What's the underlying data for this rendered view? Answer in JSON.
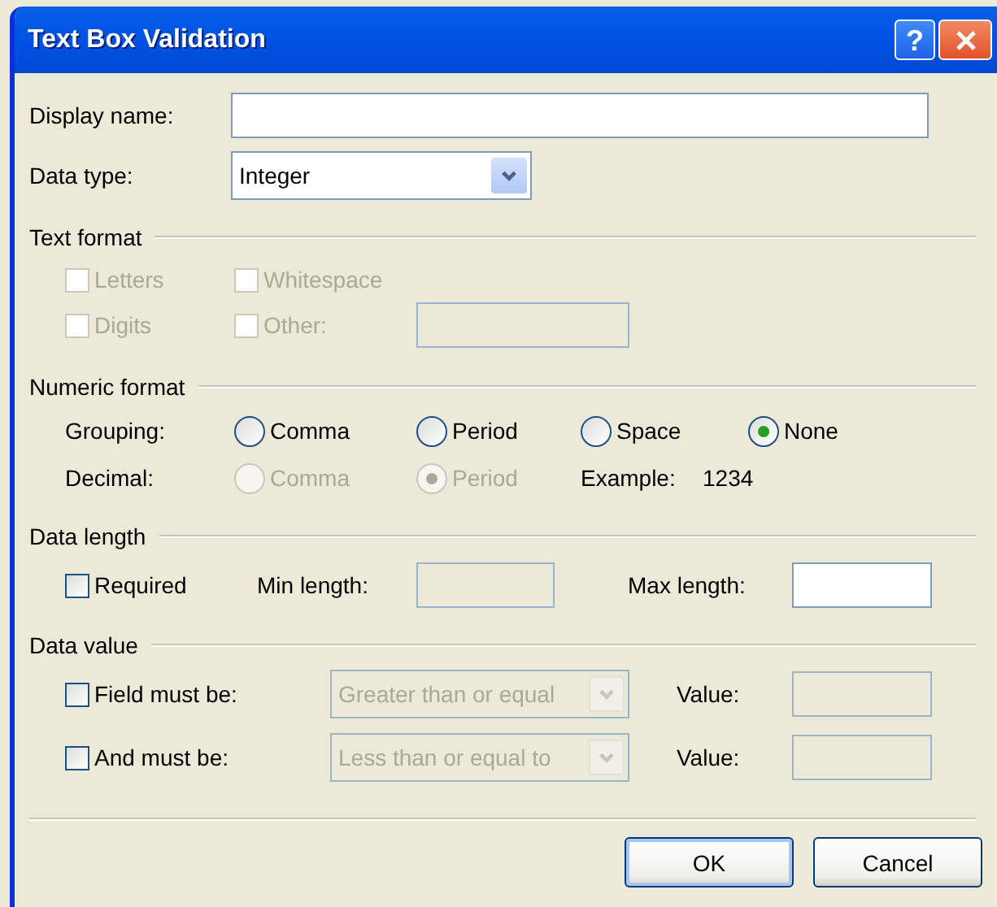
{
  "window": {
    "title": "Text Box Validation",
    "help_label": "?"
  },
  "display_name": {
    "label": "Display name:",
    "disabled": false
  },
  "data_type": {
    "label": "Data type:",
    "value": "Integer",
    "disabled": false
  },
  "text_format": {
    "title": "Text format",
    "options": [
      {
        "label": "Letters",
        "checked": false,
        "disabled": true
      },
      {
        "label": "Whitespace",
        "checked": false,
        "disabled": true
      },
      {
        "label": "Digits",
        "checked": false,
        "disabled": true
      },
      {
        "label": "Other:",
        "checked": false,
        "disabled": true
      }
    ],
    "other_field": {
      "disabled": true
    }
  },
  "numeric_format": {
    "title": "Numeric format",
    "grouping": {
      "label": "Grouping:",
      "options": [
        {
          "label": "Comma",
          "selected": false,
          "disabled": false
        },
        {
          "label": "Period",
          "selected": false,
          "disabled": false
        },
        {
          "label": "Space",
          "selected": false,
          "disabled": false
        },
        {
          "label": "None",
          "selected": true,
          "disabled": false
        }
      ]
    },
    "decimal": {
      "label": "Decimal:",
      "options": [
        {
          "label": "Comma",
          "selected": false,
          "disabled": true
        },
        {
          "label": "Period",
          "selected": true,
          "disabled": true
        }
      ]
    },
    "example": {
      "label": "Example:",
      "value": "1234"
    }
  },
  "data_length": {
    "title": "Data length",
    "required": {
      "label": "Required",
      "checked": false
    },
    "min": {
      "label": "Min length:",
      "disabled": true
    },
    "max": {
      "label": "Max length:",
      "disabled": false
    }
  },
  "data_value": {
    "title": "Data value",
    "rules": [
      {
        "label": "Field must be:",
        "checked": false,
        "operator": "Greater than or equal",
        "operator_disabled": true,
        "value_label": "Value:",
        "value_disabled": true
      },
      {
        "label": "And must be:",
        "checked": false,
        "operator": "Less than or equal to",
        "operator_disabled": true,
        "value_label": "Value:",
        "value_disabled": true
      }
    ]
  },
  "buttons": [
    {
      "label": "OK",
      "default": true
    },
    {
      "label": "Cancel",
      "default": false
    }
  ]
}
